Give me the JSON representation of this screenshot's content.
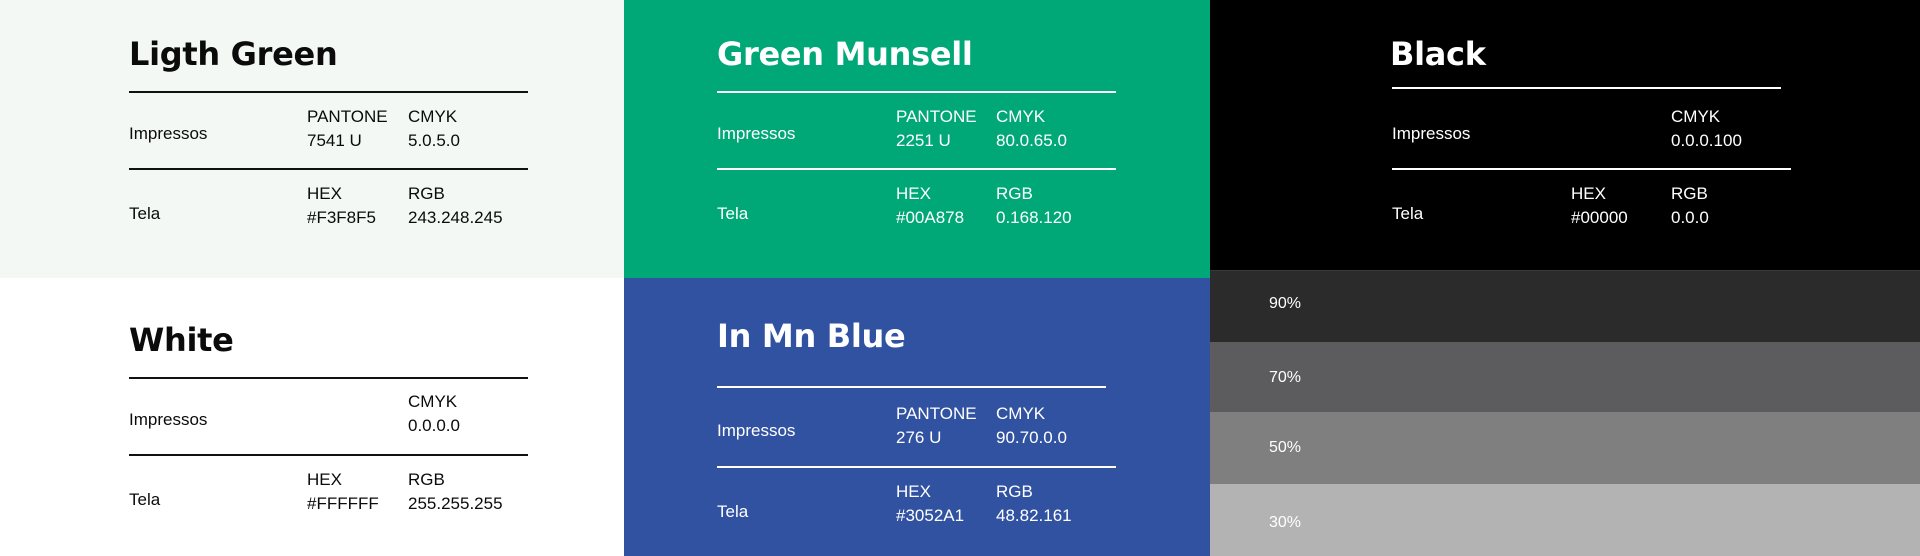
{
  "cards": {
    "light_green": {
      "title": "Ligth Green",
      "color": "#F3F8F5",
      "print_label": "Impressos",
      "screen_label": "Tela",
      "pantone_label": "PANTONE",
      "pantone_value": "7541 U",
      "cmyk_label": "CMYK",
      "cmyk_value": "5.0.5.0",
      "hex_label": "HEX",
      "hex_value": "#F3F8F5",
      "rgb_label": "RGB",
      "rgb_value": "243.248.245"
    },
    "green_munsell": {
      "title": "Green Munsell",
      "color": "#00A878",
      "print_label": "Impressos",
      "screen_label": "Tela",
      "pantone_label": "PANTONE",
      "pantone_value": "2251 U",
      "cmyk_label": "CMYK",
      "cmyk_value": "80.0.65.0",
      "hex_label": "HEX",
      "hex_value": "#00A878",
      "rgb_label": "RGB",
      "rgb_value": "0.168.120"
    },
    "black": {
      "title": "Black",
      "color": "#000000",
      "print_label": "Impressos",
      "screen_label": "Tela",
      "cmyk_label": "CMYK",
      "cmyk_value": "0.0.0.100",
      "hex_label": "HEX",
      "hex_value": "#00000",
      "rgb_label": "RGB",
      "rgb_value": "0.0.0"
    },
    "white": {
      "title": "White",
      "color": "#FFFFFF",
      "print_label": "Impressos",
      "screen_label": "Tela",
      "cmyk_label": "CMYK",
      "cmyk_value": "0.0.0.0",
      "hex_label": "HEX",
      "hex_value": "#FFFFFF",
      "rgb_label": "RGB",
      "rgb_value": "255.255.255"
    },
    "in_mn_blue": {
      "title": "In Mn Blue",
      "color": "#3052A1",
      "print_label": "Impressos",
      "screen_label": "Tela",
      "pantone_label": "PANTONE",
      "pantone_value": "276 U",
      "cmyk_label": "CMYK",
      "cmyk_value": "90.70.0.0",
      "hex_label": "HEX",
      "hex_value": "#3052A1",
      "rgb_label": "RGB",
      "rgb_value": "48.82.161"
    }
  },
  "black_tints": [
    {
      "label": "90%",
      "color": "#2B2B2B"
    },
    {
      "label": "70%",
      "color": "#5C5B5E"
    },
    {
      "label": "50%",
      "color": "#7F7F7F"
    },
    {
      "label": "30%",
      "color": "#B3B3B3"
    }
  ]
}
